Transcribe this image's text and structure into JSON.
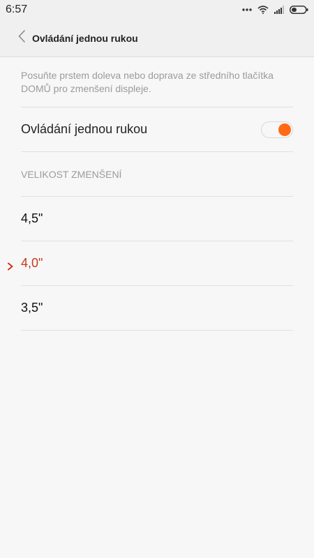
{
  "status_bar": {
    "time": "6:57"
  },
  "header": {
    "title": "Ovládání jednou rukou"
  },
  "description": "Posuňte prstem doleva nebo doprava ze středního tlačítka DOMŮ pro zmenšení displeje.",
  "toggle": {
    "label": "Ovládání jednou rukou",
    "state": "on",
    "accent_color": "#ff6a13"
  },
  "size_section": {
    "header": "VELIKOST ZMENŠENÍ",
    "options": [
      {
        "label": "4,5\"",
        "selected": false
      },
      {
        "label": "4,0\"",
        "selected": true
      },
      {
        "label": "3,5\"",
        "selected": false
      }
    ],
    "selected_color": "#c8361d"
  },
  "icons": {
    "back": "chevron-left-icon",
    "menu_dots": "more-dots-icon",
    "wifi": "wifi-icon",
    "signal": "signal-icon",
    "battery": "battery-icon",
    "check": "chevron-right-icon"
  }
}
